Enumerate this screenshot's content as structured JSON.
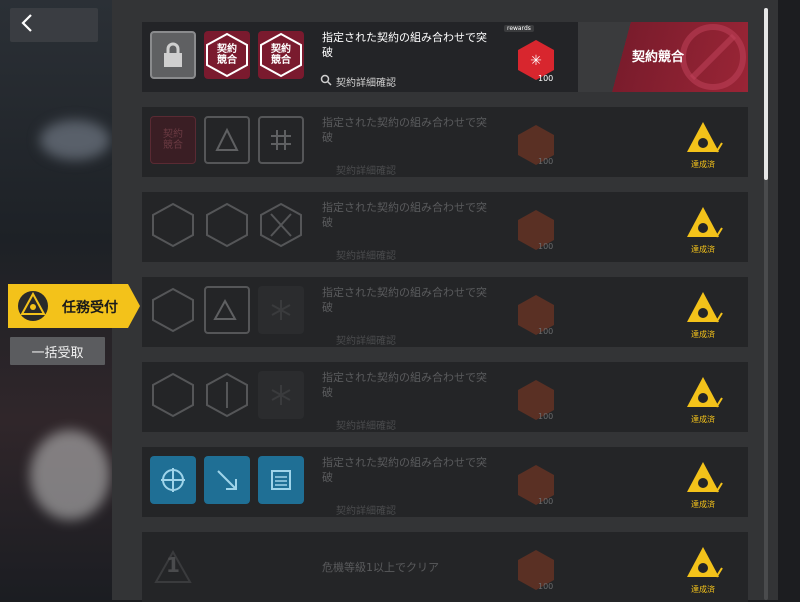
{
  "nav": {
    "back_icon": "chevron-left-icon"
  },
  "sidebar": {
    "accept_tab_label": "任務受付",
    "bulk_button_label": "一括受取"
  },
  "missions": [
    {
      "title": "指定された契約の組み合わせで突破",
      "detail_label": "契約詳細確認",
      "reward_tag": "rewards",
      "reward_count": "100",
      "status_label": "契約競合",
      "icons": [
        "lock-icon",
        "contract-conflict-icon",
        "contract-conflict-icon"
      ],
      "icon_labels": [
        "",
        "契約競合",
        "契約競合"
      ]
    },
    {
      "title": "指定された契約の組み合わせで突破",
      "detail_label": "契約詳細確認",
      "reward_count": "100",
      "status_label": "達成済",
      "icons": [
        "contract-conflict-icon",
        "volcano-icon",
        "grid-icon"
      ],
      "icon_labels": [
        "契約競合",
        "",
        ""
      ]
    },
    {
      "title": "指定された契約の組み合わせで突破",
      "detail_label": "契約詳細確認",
      "reward_count": "100",
      "status_label": "達成済",
      "icons": [
        "demon-head-icon",
        "dragon-icon",
        "crossed-swords-icon"
      ]
    },
    {
      "title": "指定された契約の組み合わせで突破",
      "detail_label": "契約詳細確認",
      "reward_count": "100",
      "status_label": "達成済",
      "icons": [
        "dragon-icon",
        "triangle-c-icon",
        "snowflake-icon"
      ]
    },
    {
      "title": "指定された契約の組み合わせで突破",
      "detail_label": "契約詳細確認",
      "reward_count": "100",
      "status_label": "達成済",
      "icons": [
        "demon-head-icon",
        "winged-sword-icon",
        "snowflake-icon"
      ]
    },
    {
      "title": "指定された契約の組み合わせで突破",
      "detail_label": "契約詳細確認",
      "reward_count": "100",
      "status_label": "達成済",
      "icons": [
        "target-icon",
        "arrow-down-right-icon",
        "document-icon"
      ]
    },
    {
      "title": "危機等級1以上でクリア",
      "reward_count": "100",
      "status_label": "達成済",
      "icons": [
        "risk-level-icon"
      ],
      "icon_labels": [
        "1"
      ]
    }
  ],
  "colors": {
    "accent_yellow": "#f3c21a",
    "contract_red": "#9a2536",
    "blue_tile": "#1f6f95",
    "panel": "#333436",
    "row": "#242527"
  }
}
